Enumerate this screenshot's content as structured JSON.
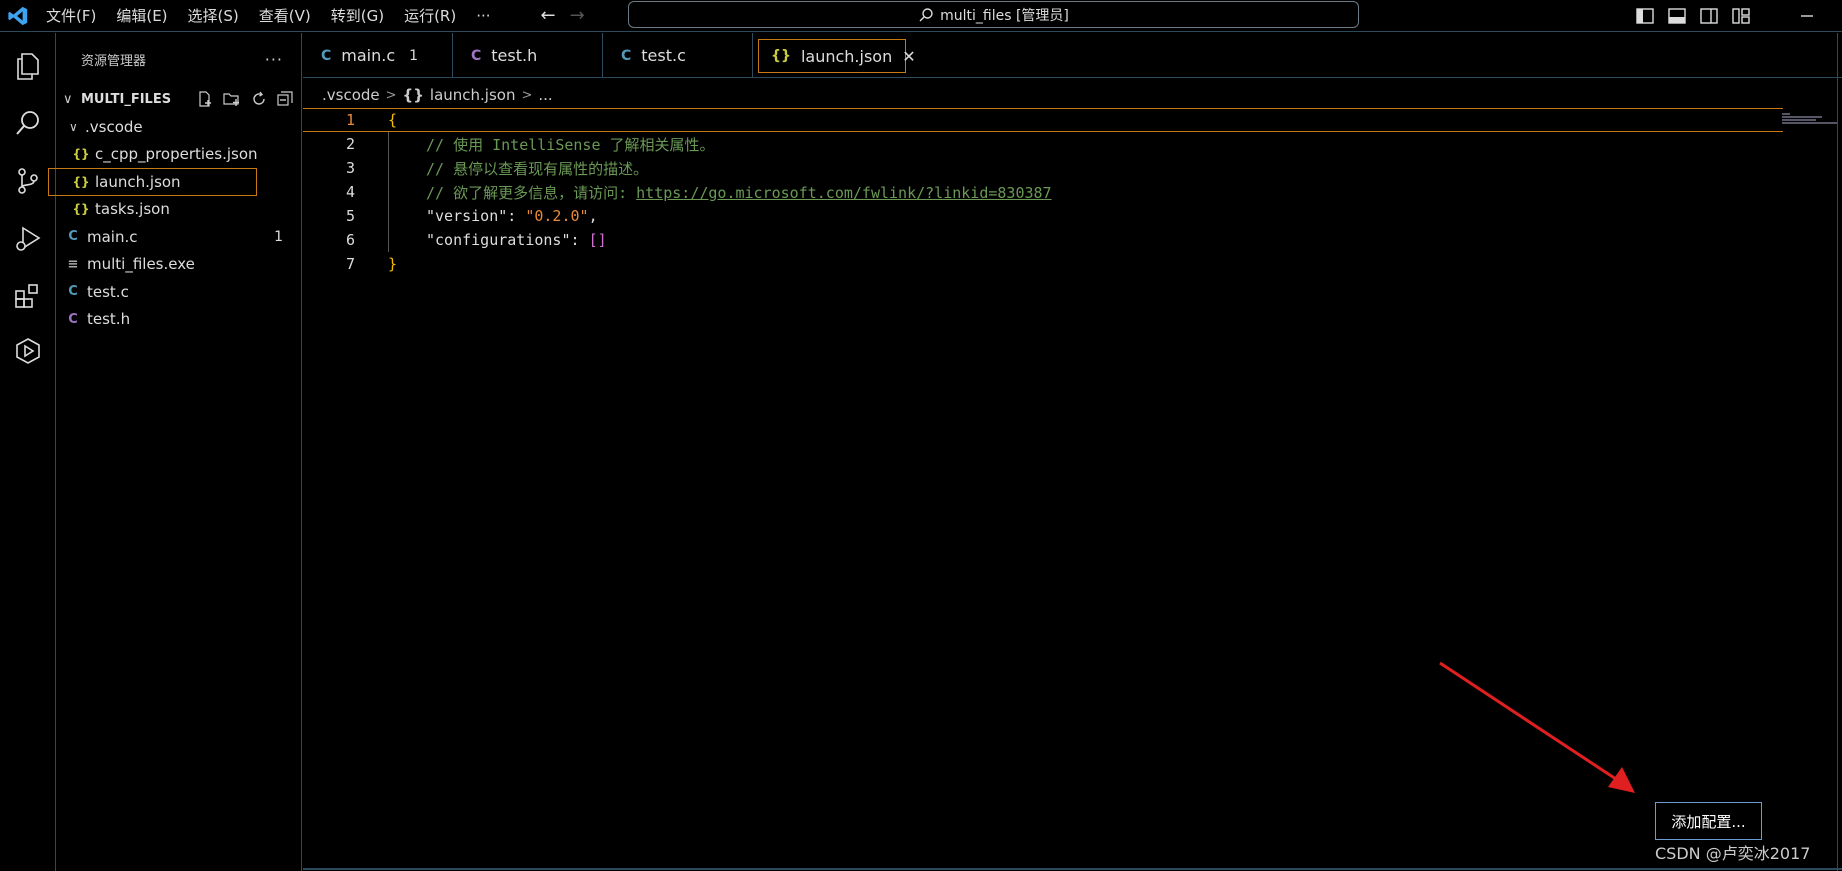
{
  "menu": [
    "文件(F)",
    "编辑(E)",
    "选择(S)",
    "查看(V)",
    "转到(G)",
    "运行(R)",
    "···"
  ],
  "search": {
    "text": "multi_files [管理员]"
  },
  "sidebar": {
    "title": "资源管理器",
    "more": "···",
    "section": "MULTI_FILES",
    "tree": [
      {
        "label": ".vscode",
        "icon": "chevron",
        "level": 1,
        "badge": ""
      },
      {
        "label": "c_cpp_properties.json",
        "icon": "{}",
        "level": 2,
        "badge": ""
      },
      {
        "label": "launch.json",
        "icon": "{}",
        "level": 2,
        "badge": "",
        "selected": true
      },
      {
        "label": "tasks.json",
        "icon": "{}",
        "level": 2,
        "badge": ""
      },
      {
        "label": "main.c",
        "icon": "C",
        "level": 1,
        "badge": "1"
      },
      {
        "label": "multi_files.exe",
        "icon": "≡",
        "level": 1,
        "badge": ""
      },
      {
        "label": "test.c",
        "icon": "C",
        "level": 1,
        "badge": ""
      },
      {
        "label": "test.h",
        "icon": "C",
        "level": 1,
        "badge": ""
      }
    ]
  },
  "tabs": [
    {
      "label": "main.c",
      "icon": "C",
      "badge": "1"
    },
    {
      "label": "test.h",
      "icon": "C",
      "badge": ""
    },
    {
      "label": "test.c",
      "icon": "C",
      "badge": ""
    },
    {
      "label": "launch.json",
      "icon": "{}",
      "badge": "",
      "close": "✕",
      "active": true
    }
  ],
  "breadcrumb": {
    "folder": ".vscode",
    "file_icon": "{}",
    "file": "launch.json",
    "more": "..."
  },
  "code": {
    "line_numbers": [
      "1",
      "2",
      "3",
      "4",
      "5",
      "6",
      "7"
    ],
    "l1": "{",
    "l2": "// 使用 IntelliSense 了解相关属性。",
    "l3": "// 悬停以查看现有属性的描述。",
    "l4_prefix": "// 欲了解更多信息，请访问: ",
    "l4_link": "https://go.microsoft.com/fwlink/?linkid=830387",
    "l5_key": "\"version\"",
    "l5_colon": ": ",
    "l5_value": "\"0.2.0\"",
    "l5_comma": ",",
    "l6_key": "\"configurations\"",
    "l6_colon": ": ",
    "l6_value": "[]",
    "l7": "}"
  },
  "add_config_button": "添加配置...",
  "watermark": "CSDN @卢奕冰2017",
  "colors": {
    "accent_border": "#c77a14",
    "json_icon": "#cbcb41",
    "c_icon": "#519aba",
    "h_icon": "#a074c4"
  }
}
